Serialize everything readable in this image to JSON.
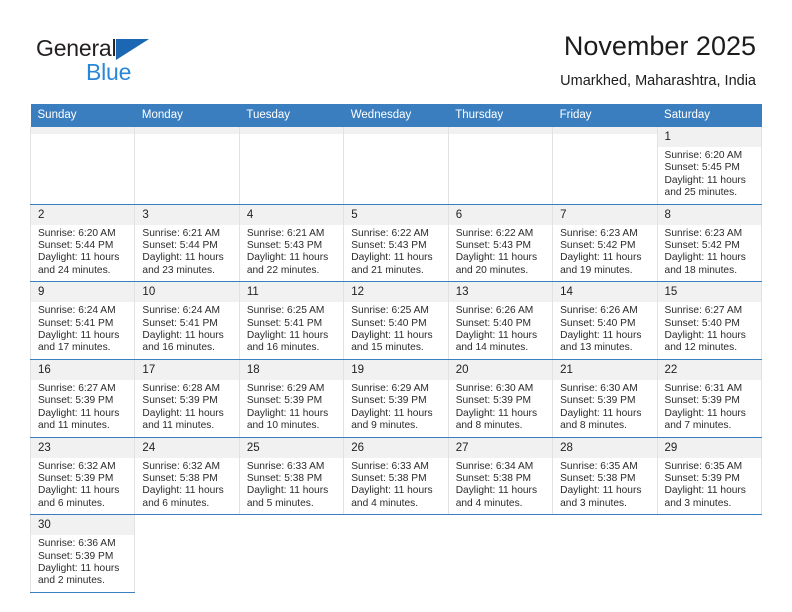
{
  "brand": {
    "name_top": "General",
    "name_bottom": "Blue",
    "accent_color": "#1b67b3",
    "accent_light": "#2a87d8",
    "triangle_icon": "triangle-icon"
  },
  "header": {
    "title": "November 2025",
    "subtitle": "Umarkhed, Maharashtra, India"
  },
  "theme": {
    "header_row_bg": "#3b7ebf",
    "daynum_bg": "#f1f1f1",
    "row_divider": "#3b7ebf",
    "cell_border": "#e2e2e2"
  },
  "calendar": {
    "weekdays": [
      "Sunday",
      "Monday",
      "Tuesday",
      "Wednesday",
      "Thursday",
      "Friday",
      "Saturday"
    ],
    "weeks": [
      [
        {
          "day": "",
          "sunrise": "",
          "sunset": "",
          "daylight_1": "",
          "daylight_2": "",
          "empty": true
        },
        {
          "day": "",
          "sunrise": "",
          "sunset": "",
          "daylight_1": "",
          "daylight_2": "",
          "empty": true
        },
        {
          "day": "",
          "sunrise": "",
          "sunset": "",
          "daylight_1": "",
          "daylight_2": "",
          "empty": true
        },
        {
          "day": "",
          "sunrise": "",
          "sunset": "",
          "daylight_1": "",
          "daylight_2": "",
          "empty": true
        },
        {
          "day": "",
          "sunrise": "",
          "sunset": "",
          "daylight_1": "",
          "daylight_2": "",
          "empty": true
        },
        {
          "day": "",
          "sunrise": "",
          "sunset": "",
          "daylight_1": "",
          "daylight_2": "",
          "empty": true
        },
        {
          "day": "1",
          "sunrise": "Sunrise: 6:20 AM",
          "sunset": "Sunset: 5:45 PM",
          "daylight_1": "Daylight: 11 hours",
          "daylight_2": "and 25 minutes.",
          "empty": false
        }
      ],
      [
        {
          "day": "2",
          "sunrise": "Sunrise: 6:20 AM",
          "sunset": "Sunset: 5:44 PM",
          "daylight_1": "Daylight: 11 hours",
          "daylight_2": "and 24 minutes.",
          "empty": false
        },
        {
          "day": "3",
          "sunrise": "Sunrise: 6:21 AM",
          "sunset": "Sunset: 5:44 PM",
          "daylight_1": "Daylight: 11 hours",
          "daylight_2": "and 23 minutes.",
          "empty": false
        },
        {
          "day": "4",
          "sunrise": "Sunrise: 6:21 AM",
          "sunset": "Sunset: 5:43 PM",
          "daylight_1": "Daylight: 11 hours",
          "daylight_2": "and 22 minutes.",
          "empty": false
        },
        {
          "day": "5",
          "sunrise": "Sunrise: 6:22 AM",
          "sunset": "Sunset: 5:43 PM",
          "daylight_1": "Daylight: 11 hours",
          "daylight_2": "and 21 minutes.",
          "empty": false
        },
        {
          "day": "6",
          "sunrise": "Sunrise: 6:22 AM",
          "sunset": "Sunset: 5:43 PM",
          "daylight_1": "Daylight: 11 hours",
          "daylight_2": "and 20 minutes.",
          "empty": false
        },
        {
          "day": "7",
          "sunrise": "Sunrise: 6:23 AM",
          "sunset": "Sunset: 5:42 PM",
          "daylight_1": "Daylight: 11 hours",
          "daylight_2": "and 19 minutes.",
          "empty": false
        },
        {
          "day": "8",
          "sunrise": "Sunrise: 6:23 AM",
          "sunset": "Sunset: 5:42 PM",
          "daylight_1": "Daylight: 11 hours",
          "daylight_2": "and 18 minutes.",
          "empty": false
        }
      ],
      [
        {
          "day": "9",
          "sunrise": "Sunrise: 6:24 AM",
          "sunset": "Sunset: 5:41 PM",
          "daylight_1": "Daylight: 11 hours",
          "daylight_2": "and 17 minutes.",
          "empty": false
        },
        {
          "day": "10",
          "sunrise": "Sunrise: 6:24 AM",
          "sunset": "Sunset: 5:41 PM",
          "daylight_1": "Daylight: 11 hours",
          "daylight_2": "and 16 minutes.",
          "empty": false
        },
        {
          "day": "11",
          "sunrise": "Sunrise: 6:25 AM",
          "sunset": "Sunset: 5:41 PM",
          "daylight_1": "Daylight: 11 hours",
          "daylight_2": "and 16 minutes.",
          "empty": false
        },
        {
          "day": "12",
          "sunrise": "Sunrise: 6:25 AM",
          "sunset": "Sunset: 5:40 PM",
          "daylight_1": "Daylight: 11 hours",
          "daylight_2": "and 15 minutes.",
          "empty": false
        },
        {
          "day": "13",
          "sunrise": "Sunrise: 6:26 AM",
          "sunset": "Sunset: 5:40 PM",
          "daylight_1": "Daylight: 11 hours",
          "daylight_2": "and 14 minutes.",
          "empty": false
        },
        {
          "day": "14",
          "sunrise": "Sunrise: 6:26 AM",
          "sunset": "Sunset: 5:40 PM",
          "daylight_1": "Daylight: 11 hours",
          "daylight_2": "and 13 minutes.",
          "empty": false
        },
        {
          "day": "15",
          "sunrise": "Sunrise: 6:27 AM",
          "sunset": "Sunset: 5:40 PM",
          "daylight_1": "Daylight: 11 hours",
          "daylight_2": "and 12 minutes.",
          "empty": false
        }
      ],
      [
        {
          "day": "16",
          "sunrise": "Sunrise: 6:27 AM",
          "sunset": "Sunset: 5:39 PM",
          "daylight_1": "Daylight: 11 hours",
          "daylight_2": "and 11 minutes.",
          "empty": false
        },
        {
          "day": "17",
          "sunrise": "Sunrise: 6:28 AM",
          "sunset": "Sunset: 5:39 PM",
          "daylight_1": "Daylight: 11 hours",
          "daylight_2": "and 11 minutes.",
          "empty": false
        },
        {
          "day": "18",
          "sunrise": "Sunrise: 6:29 AM",
          "sunset": "Sunset: 5:39 PM",
          "daylight_1": "Daylight: 11 hours",
          "daylight_2": "and 10 minutes.",
          "empty": false
        },
        {
          "day": "19",
          "sunrise": "Sunrise: 6:29 AM",
          "sunset": "Sunset: 5:39 PM",
          "daylight_1": "Daylight: 11 hours",
          "daylight_2": "and 9 minutes.",
          "empty": false
        },
        {
          "day": "20",
          "sunrise": "Sunrise: 6:30 AM",
          "sunset": "Sunset: 5:39 PM",
          "daylight_1": "Daylight: 11 hours",
          "daylight_2": "and 8 minutes.",
          "empty": false
        },
        {
          "day": "21",
          "sunrise": "Sunrise: 6:30 AM",
          "sunset": "Sunset: 5:39 PM",
          "daylight_1": "Daylight: 11 hours",
          "daylight_2": "and 8 minutes.",
          "empty": false
        },
        {
          "day": "22",
          "sunrise": "Sunrise: 6:31 AM",
          "sunset": "Sunset: 5:39 PM",
          "daylight_1": "Daylight: 11 hours",
          "daylight_2": "and 7 minutes.",
          "empty": false
        }
      ],
      [
        {
          "day": "23",
          "sunrise": "Sunrise: 6:32 AM",
          "sunset": "Sunset: 5:39 PM",
          "daylight_1": "Daylight: 11 hours",
          "daylight_2": "and 6 minutes.",
          "empty": false
        },
        {
          "day": "24",
          "sunrise": "Sunrise: 6:32 AM",
          "sunset": "Sunset: 5:38 PM",
          "daylight_1": "Daylight: 11 hours",
          "daylight_2": "and 6 minutes.",
          "empty": false
        },
        {
          "day": "25",
          "sunrise": "Sunrise: 6:33 AM",
          "sunset": "Sunset: 5:38 PM",
          "daylight_1": "Daylight: 11 hours",
          "daylight_2": "and 5 minutes.",
          "empty": false
        },
        {
          "day": "26",
          "sunrise": "Sunrise: 6:33 AM",
          "sunset": "Sunset: 5:38 PM",
          "daylight_1": "Daylight: 11 hours",
          "daylight_2": "and 4 minutes.",
          "empty": false
        },
        {
          "day": "27",
          "sunrise": "Sunrise: 6:34 AM",
          "sunset": "Sunset: 5:38 PM",
          "daylight_1": "Daylight: 11 hours",
          "daylight_2": "and 4 minutes.",
          "empty": false
        },
        {
          "day": "28",
          "sunrise": "Sunrise: 6:35 AM",
          "sunset": "Sunset: 5:38 PM",
          "daylight_1": "Daylight: 11 hours",
          "daylight_2": "and 3 minutes.",
          "empty": false
        },
        {
          "day": "29",
          "sunrise": "Sunrise: 6:35 AM",
          "sunset": "Sunset: 5:39 PM",
          "daylight_1": "Daylight: 11 hours",
          "daylight_2": "and 3 minutes.",
          "empty": false
        }
      ],
      [
        {
          "day": "30",
          "sunrise": "Sunrise: 6:36 AM",
          "sunset": "Sunset: 5:39 PM",
          "daylight_1": "Daylight: 11 hours",
          "daylight_2": "and 2 minutes.",
          "empty": false
        },
        {
          "day": "",
          "sunrise": "",
          "sunset": "",
          "daylight_1": "",
          "daylight_2": "",
          "blank": true
        },
        {
          "day": "",
          "sunrise": "",
          "sunset": "",
          "daylight_1": "",
          "daylight_2": "",
          "blank": true
        },
        {
          "day": "",
          "sunrise": "",
          "sunset": "",
          "daylight_1": "",
          "daylight_2": "",
          "blank": true
        },
        {
          "day": "",
          "sunrise": "",
          "sunset": "",
          "daylight_1": "",
          "daylight_2": "",
          "blank": true
        },
        {
          "day": "",
          "sunrise": "",
          "sunset": "",
          "daylight_1": "",
          "daylight_2": "",
          "blank": true
        },
        {
          "day": "",
          "sunrise": "",
          "sunset": "",
          "daylight_1": "",
          "daylight_2": "",
          "blank": true
        }
      ]
    ]
  }
}
